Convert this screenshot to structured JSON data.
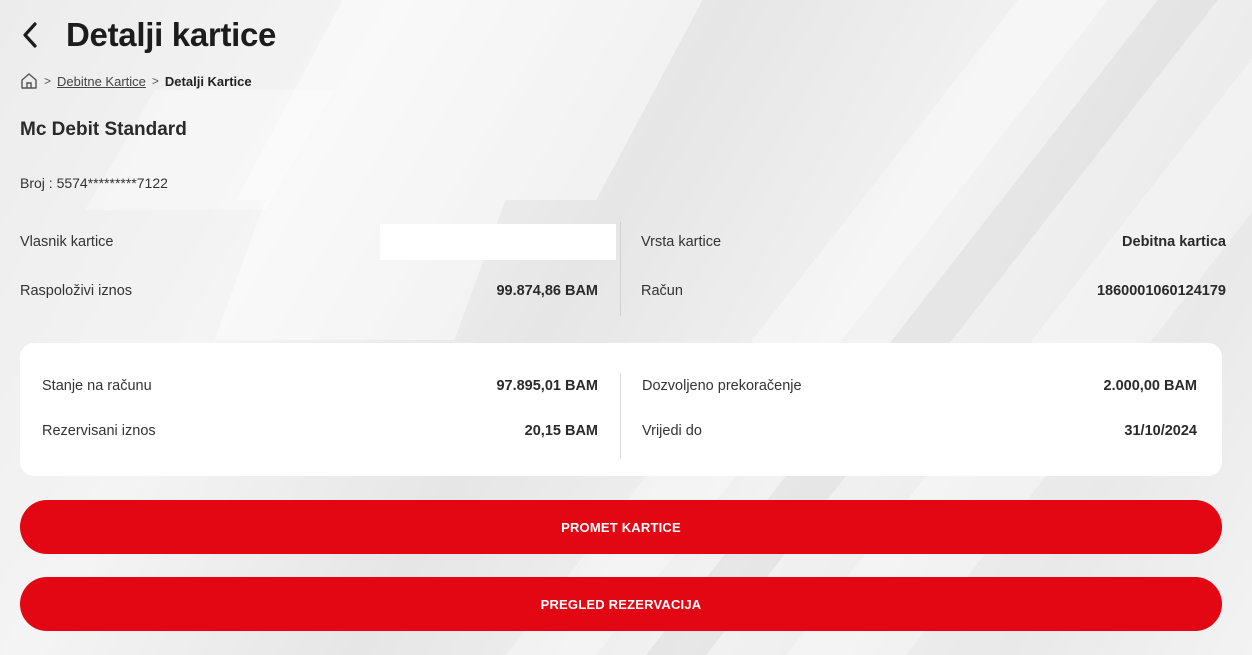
{
  "header": {
    "title": "Detalji kartice"
  },
  "breadcrumb": {
    "items": [
      "Debitne Kartice",
      "Detalji Kartice"
    ]
  },
  "card": {
    "name": "Mc Debit Standard",
    "number_label": "Broj : 5574*********7122"
  },
  "details": {
    "left": [
      {
        "label": "Vlasnik kartice",
        "value": ""
      },
      {
        "label": "Raspoloživi iznos",
        "value": "99.874,86 BAM"
      }
    ],
    "right": [
      {
        "label": "Vrsta kartice",
        "value": "Debitna kartica"
      },
      {
        "label": "Račun",
        "value": "1860001060124179"
      }
    ]
  },
  "summary": {
    "left": [
      {
        "label": "Stanje na računu",
        "value": "97.895,01 BAM"
      },
      {
        "label": "Rezervisani iznos",
        "value": "20,15 BAM"
      }
    ],
    "right": [
      {
        "label": "Dozvoljeno prekoračenje",
        "value": "2.000,00 BAM"
      },
      {
        "label": "Vrijedi do",
        "value": "31/10/2024"
      }
    ]
  },
  "buttons": {
    "transactions": "PROMET KARTICE",
    "reservations": "PREGLED REZERVACIJA"
  },
  "colors": {
    "accent": "#e30613",
    "background": "#eeeeee",
    "panel": "#ffffff"
  },
  "icons": {
    "back": "chevron-left-icon",
    "home": "home-icon",
    "separator": "chevron-right-icon"
  }
}
